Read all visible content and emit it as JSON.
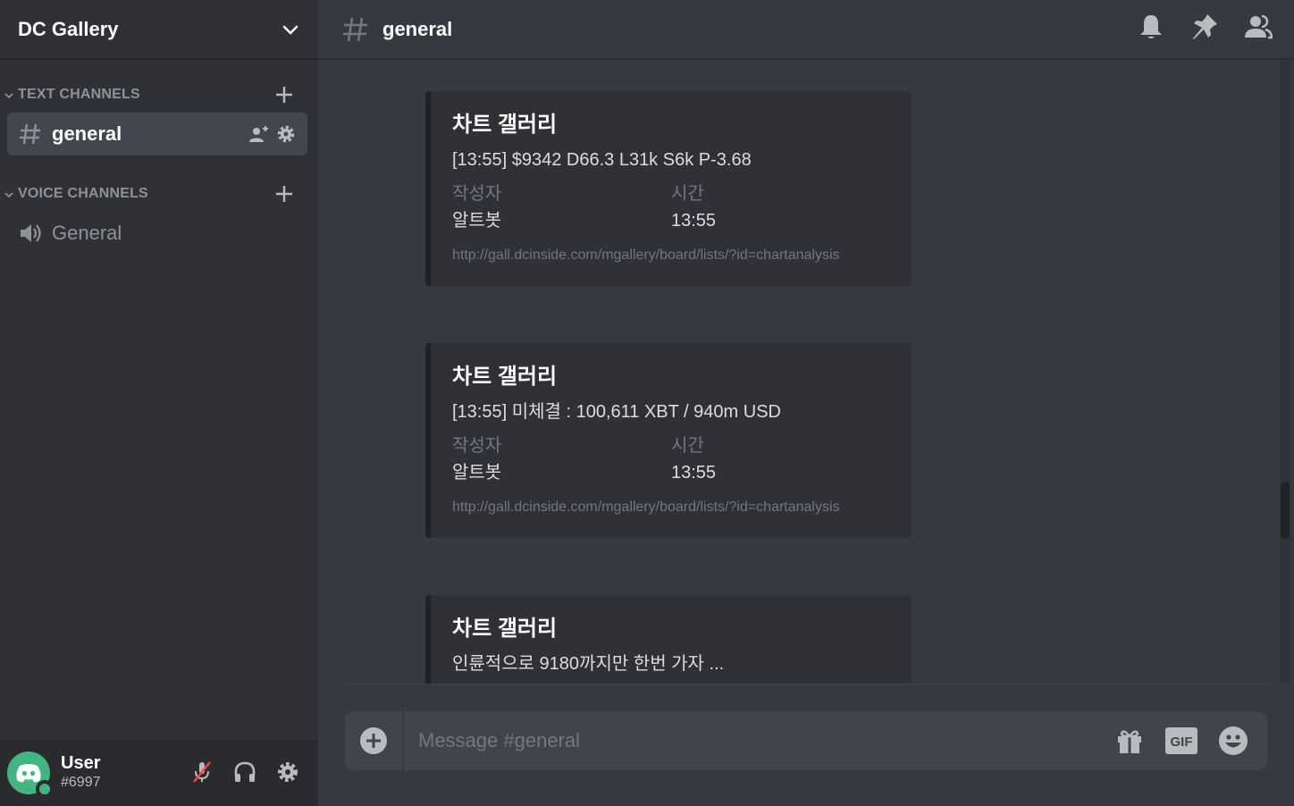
{
  "server": {
    "name": "DC Gallery"
  },
  "categories": {
    "text": {
      "label": "TEXT CHANNELS"
    },
    "voice": {
      "label": "VOICE CHANNELS"
    }
  },
  "channels": {
    "text": [
      {
        "name": "general",
        "active": true
      }
    ],
    "voice": [
      {
        "name": "General"
      }
    ]
  },
  "user": {
    "name": "User",
    "tag": "#6997",
    "status": "online"
  },
  "header": {
    "channel": "general"
  },
  "messages": [
    {
      "title": "차트 갤러리",
      "description": "[13:55] $9342 D66.3 L31k S6k P-3.68",
      "field1_name": "작성자",
      "field1_value": "알트봇",
      "field2_name": "시간",
      "field2_value": "13:55",
      "footer": "http://gall.dcinside.com/mgallery/board/lists/?id=chartanalysis"
    },
    {
      "title": "차트 갤러리",
      "description": "[13:55] 미체결 : 100,611 XBT / 940m USD",
      "field1_name": "작성자",
      "field1_value": "알트봇",
      "field2_name": "시간",
      "field2_value": "13:55",
      "footer": "http://gall.dcinside.com/mgallery/board/lists/?id=chartanalysis"
    },
    {
      "title": "차트 갤러리",
      "description": "인륜적으로 9180까지만 한번 가자 ..."
    }
  ],
  "composer": {
    "placeholder": "Message #general",
    "value": ""
  },
  "icons": {
    "header": [
      "bell-icon",
      "pin-icon",
      "members-icon"
    ],
    "composer": [
      "add-icon",
      "gift-icon",
      "gif-icon",
      "emoji-icon"
    ],
    "user": [
      "mic-muted-icon",
      "headphones-icon",
      "gear-icon"
    ]
  },
  "colors": {
    "background": "#36393f",
    "sidebar": "#2f3136",
    "userbar": "#292b2f",
    "embed": "#2f3136",
    "online": "#43b581",
    "muted_red": "#f04747"
  }
}
